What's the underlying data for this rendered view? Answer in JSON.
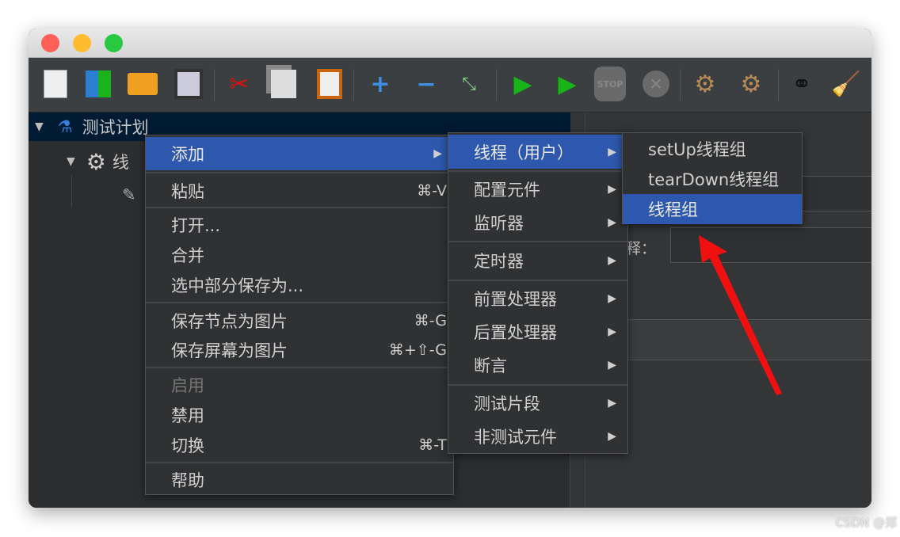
{
  "window": {
    "traffic_lights": {
      "close": "#fe5f57",
      "minimize": "#febc2e",
      "zoom": "#28c840"
    }
  },
  "toolbar": {
    "icons": [
      "new-icon",
      "templates-icon",
      "open-icon",
      "save-icon",
      "cut-icon",
      "copy-icon",
      "paste-icon",
      "expand-icon",
      "collapse-icon",
      "toggle-icon",
      "start-icon",
      "start-no-pauses-icon",
      "stop-icon",
      "shutdown-icon",
      "clear-icon",
      "clear-all-icon",
      "search-icon",
      "reset-search-icon"
    ],
    "stop_text": "STOP"
  },
  "tree": {
    "root": "测试计划",
    "child": "线"
  },
  "context_menu": {
    "items": [
      {
        "label": "添加",
        "submenu": true
      },
      {
        "label": "粘贴",
        "shortcut": "⌘-V"
      },
      {
        "label": "打开..."
      },
      {
        "label": "合并"
      },
      {
        "label": "选中部分保存为..."
      },
      {
        "label": "保存节点为图片",
        "shortcut": "⌘-G"
      },
      {
        "label": "保存屏幕为图片",
        "shortcut": "⌘+⇧-G"
      },
      {
        "label": "启用",
        "disabled": true
      },
      {
        "label": "禁用"
      },
      {
        "label": "切换",
        "shortcut": "⌘-T"
      },
      {
        "label": "帮助"
      }
    ]
  },
  "add_submenu": {
    "items": [
      {
        "label": "线程（用户）"
      },
      {
        "label": "配置元件"
      },
      {
        "label": "监听器"
      },
      {
        "label": "定时器"
      },
      {
        "label": "前置处理器"
      },
      {
        "label": "后置处理器"
      },
      {
        "label": "断言"
      },
      {
        "label": "测试片段"
      },
      {
        "label": "非测试元件"
      }
    ]
  },
  "thread_submenu": {
    "items": [
      {
        "label": "setUp线程组"
      },
      {
        "label": "tearDown线程组"
      },
      {
        "label": "线程组"
      }
    ]
  },
  "right_panel": {
    "comment_label": "释："
  },
  "watermark": "CSDN @郑"
}
